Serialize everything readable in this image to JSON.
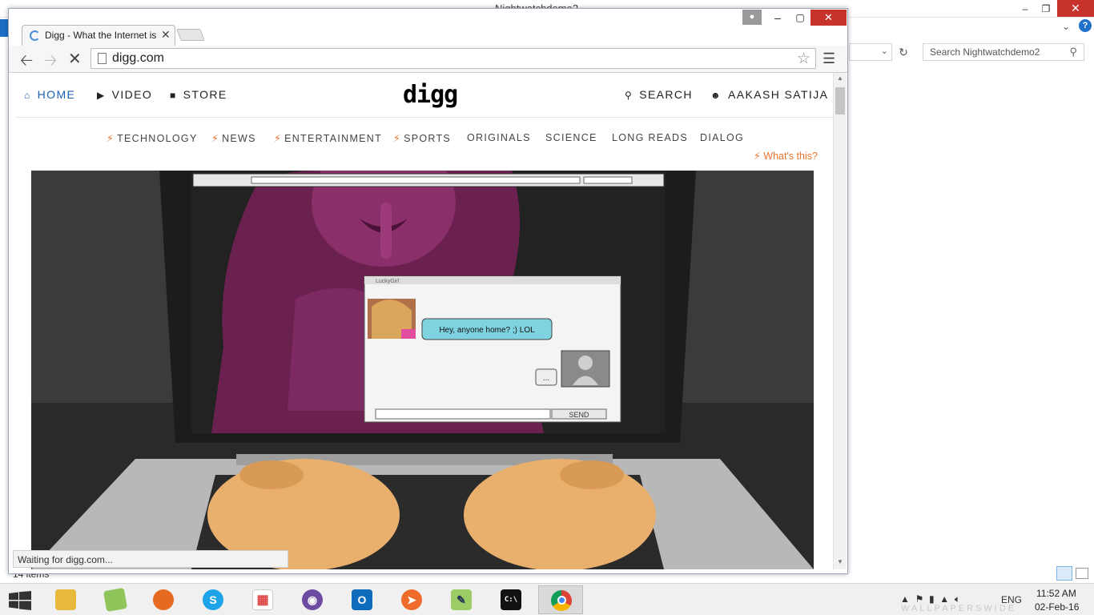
{
  "background_window": {
    "title": "Nightwatchdemo2",
    "search_placeholder": "Search Nightwatchdemo2",
    "items_count": "14 items"
  },
  "browser": {
    "tab_title": "Digg - What the Internet is",
    "url": "digg.com",
    "status_text": "Waiting for digg.com..."
  },
  "site": {
    "nav": {
      "home": "HOME",
      "video": "VIDEO",
      "store": "STORE",
      "logo": "digg",
      "search": "SEARCH",
      "user": "AAKASH SATIJA"
    },
    "categories": [
      {
        "label": "TECHNOLOGY",
        "bolt": true
      },
      {
        "label": "NEWS",
        "bolt": true
      },
      {
        "label": "ENTERTAINMENT",
        "bolt": true
      },
      {
        "label": "SPORTS",
        "bolt": true
      },
      {
        "label": "ORIGINALS",
        "bolt": false
      },
      {
        "label": "SCIENCE",
        "bolt": false
      },
      {
        "label": "LONG READS",
        "bolt": false
      },
      {
        "label": "DIALOG",
        "bolt": false
      }
    ],
    "whats_this": "What's this?",
    "hero": {
      "chat_title": "LuckyGirl",
      "chat_message": "Hey, anyone home? ;) LOL",
      "typing": "...",
      "send": "SEND"
    },
    "accent_color": "#e8742e",
    "link_color": "#1a5fb4"
  },
  "taskbar": {
    "apps": [
      {
        "name": "File Explorer",
        "icon": "folder-icon"
      },
      {
        "name": "Maps",
        "icon": "map-icon"
      },
      {
        "name": "Firefox",
        "icon": "firefox-icon"
      },
      {
        "name": "Skype",
        "icon": "skype-icon",
        "letter": "S"
      },
      {
        "name": "Apps",
        "icon": "apps-icon"
      },
      {
        "name": "GitHub",
        "icon": "github-icon"
      },
      {
        "name": "Outlook",
        "icon": "outlook-icon",
        "letter": "O"
      },
      {
        "name": "Tool",
        "icon": "rocket-icon"
      },
      {
        "name": "Notepad++",
        "icon": "notepad-icon"
      },
      {
        "name": "Command Prompt",
        "icon": "cmd-icon",
        "letter": "C:\\"
      },
      {
        "name": "Chrome",
        "icon": "chrome-icon"
      }
    ],
    "language": "ENG",
    "time": "11:52 AM",
    "date": "02-Feb-16"
  }
}
